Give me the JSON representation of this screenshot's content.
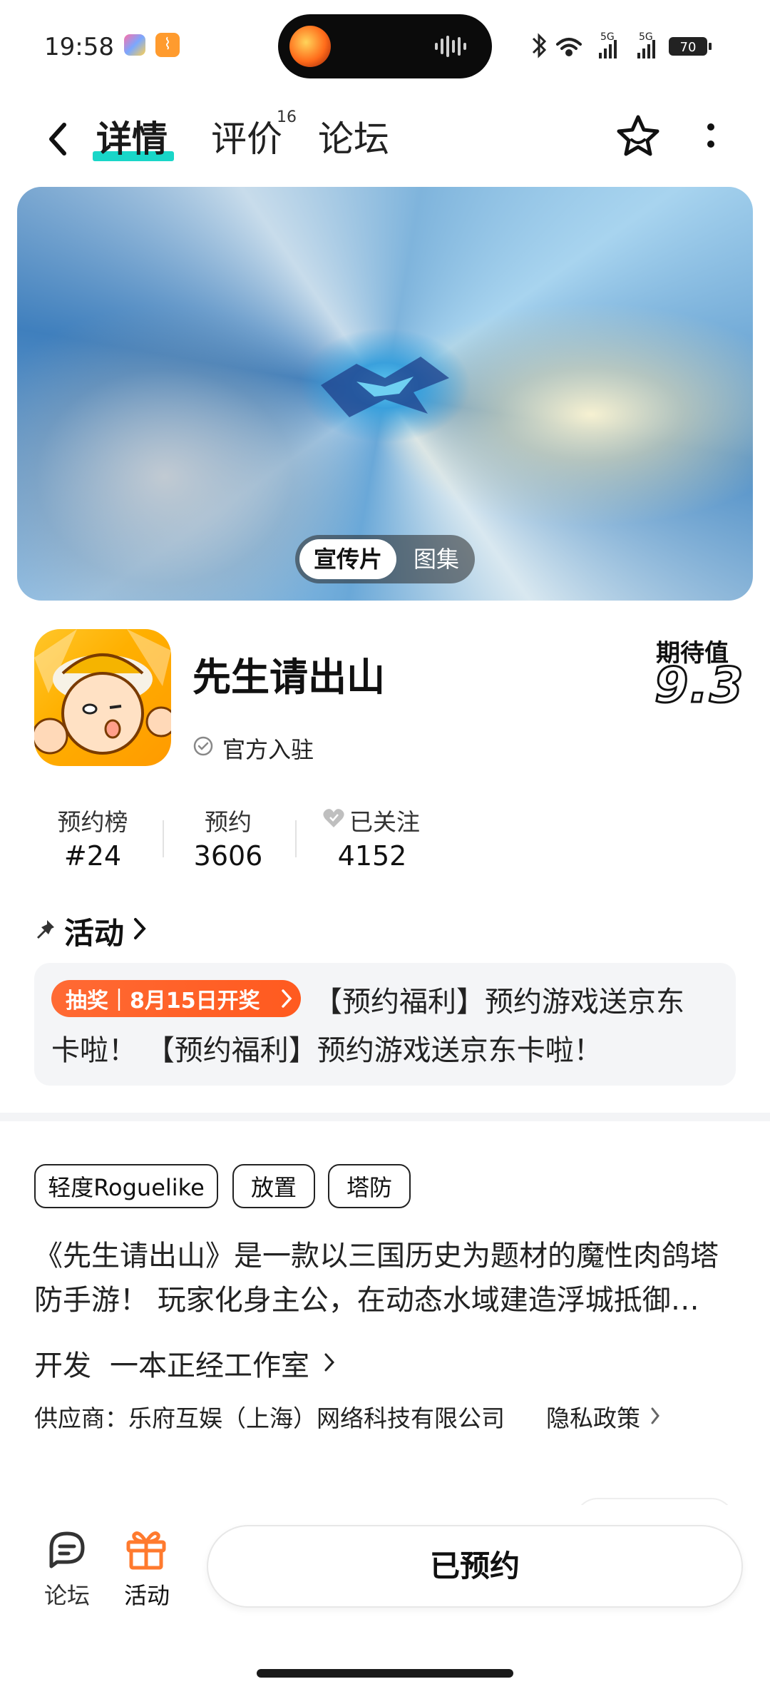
{
  "status_bar": {
    "time": "19:58",
    "signal_1": "5G",
    "signal_2": "5G",
    "battery": "70"
  },
  "nav": {
    "tabs": [
      {
        "label": "详情",
        "active": true
      },
      {
        "label": "评价",
        "badge": "16"
      },
      {
        "label": "论坛"
      }
    ],
    "icons": [
      "back-icon",
      "star-icon",
      "more-icon"
    ]
  },
  "banner": {
    "toggle": [
      "宣传片",
      "图集"
    ],
    "selected": "宣传片"
  },
  "game": {
    "title": "先生请出山",
    "official": "官方入驻",
    "expect_label": "期待值",
    "expect_value": "9.3"
  },
  "stats": [
    {
      "label": "预约榜",
      "value": "#24"
    },
    {
      "label": "预约",
      "value": "3606"
    },
    {
      "label": "已关注",
      "value": "4152"
    }
  ],
  "activity": {
    "title": "活动",
    "badge": "抽奖｜8月15日开奖",
    "line1": "【预约福利】预约游戏送京东",
    "line2": "卡啦！ 【预约福利】预约游戏送京东卡啦！"
  },
  "tags": [
    "轻度Roguelike",
    "放置",
    "塔防"
  ],
  "description": "《先生请出山》是一款以三国历史为题材的魔性肉鸽塔防手游！ 玩家化身主公，在动态水域建造浮城抵御…",
  "developer": {
    "label": "开发",
    "name": "一本正经工作室"
  },
  "supplier": "供应商：乐府互娱（上海）网络科技有限公司",
  "privacy": "隐私政策",
  "bottom_bar": {
    "forum": "论坛",
    "activity": "活动",
    "reserved": "已预约"
  },
  "colors": {
    "accent_teal": "#19d6c8",
    "badge_orange": "#ff5a1f",
    "gift_orange": "#ff7a2e"
  }
}
